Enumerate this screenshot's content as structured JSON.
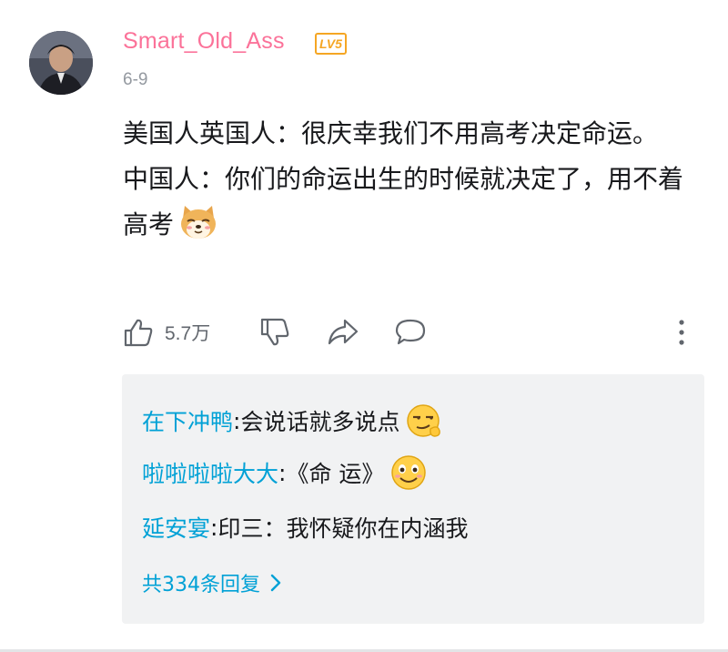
{
  "comment": {
    "username": "Smart_Old_Ass",
    "level": "LV5",
    "date": "6-9",
    "content": {
      "line1": "美国人英国人：很庆幸我们不用高考决定命运。",
      "line2": "中国人：你们的命运出生的时候就决定了，用不着高考",
      "line2_emoji": "doge-emoji"
    },
    "actions": {
      "like_count": "5.7万",
      "like_icon": "thumb-up-icon",
      "dislike_icon": "thumb-down-icon",
      "share_icon": "share-icon",
      "reply_icon": "comment-icon",
      "more_icon": "more-vertical-icon"
    }
  },
  "replies": {
    "items": [
      {
        "name": "在下冲鸭",
        "sep": ": ",
        "text": "会说话就多说点",
        "emoji": "smirk-emoji"
      },
      {
        "name": "啦啦啦啦大大",
        "sep": ": ",
        "text": "《命 运》",
        "emoji": "smile-emoji"
      },
      {
        "name": "延安宴",
        "sep": ": ",
        "text": "印三：我怀疑你在内涵我",
        "emoji": ""
      }
    ],
    "more_label": "共334条回复"
  },
  "colors": {
    "username": "#fb7299",
    "level_badge": "#f5a623",
    "link": "#00a1d6",
    "meta": "#9499a0",
    "reply_bg": "#f1f2f3"
  }
}
